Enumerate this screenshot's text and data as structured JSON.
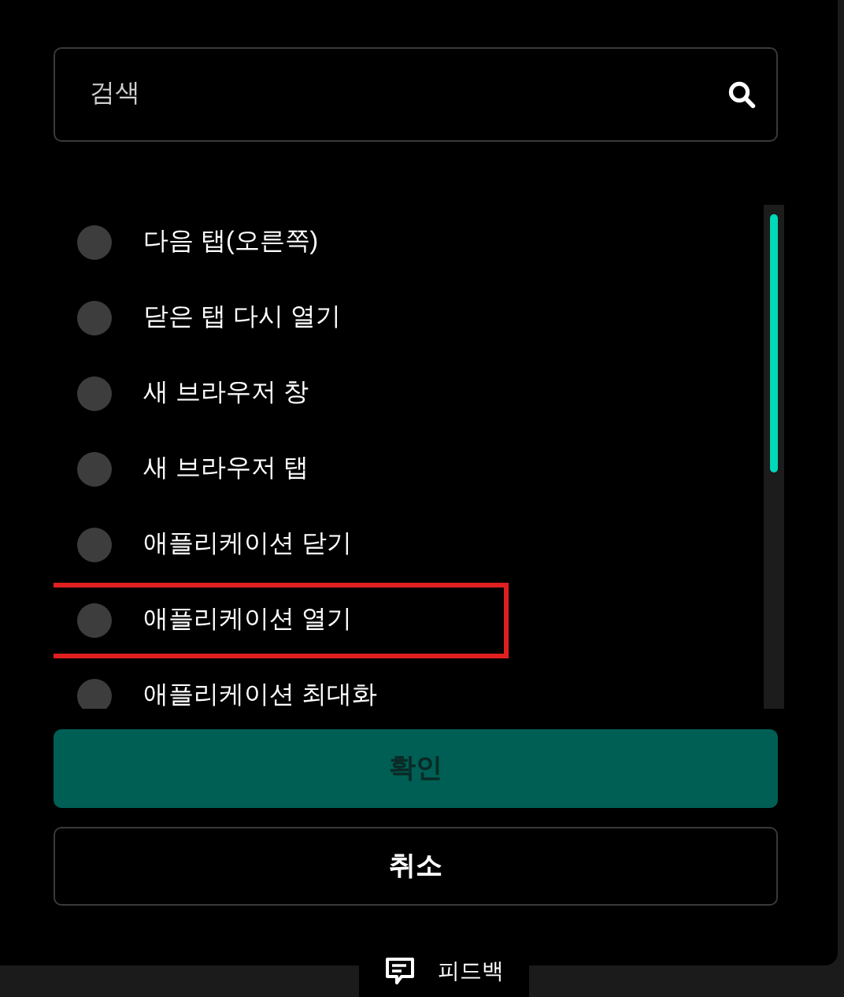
{
  "search": {
    "placeholder": "검색"
  },
  "options": [
    {
      "label": "다음 탭(오른쪽)",
      "selected": false,
      "highlighted": false
    },
    {
      "label": "닫은 탭 다시 열기",
      "selected": false,
      "highlighted": false
    },
    {
      "label": "새 브라우저 창",
      "selected": false,
      "highlighted": false
    },
    {
      "label": "새 브라우저 탭",
      "selected": false,
      "highlighted": false
    },
    {
      "label": "애플리케이션 닫기",
      "selected": false,
      "highlighted": false
    },
    {
      "label": "애플리케이션 열기",
      "selected": false,
      "highlighted": true
    },
    {
      "label": "애플리케이션 최대화",
      "selected": false,
      "highlighted": false
    }
  ],
  "buttons": {
    "confirm": "확인",
    "cancel": "취소"
  },
  "feedback": {
    "label": "피드백"
  }
}
